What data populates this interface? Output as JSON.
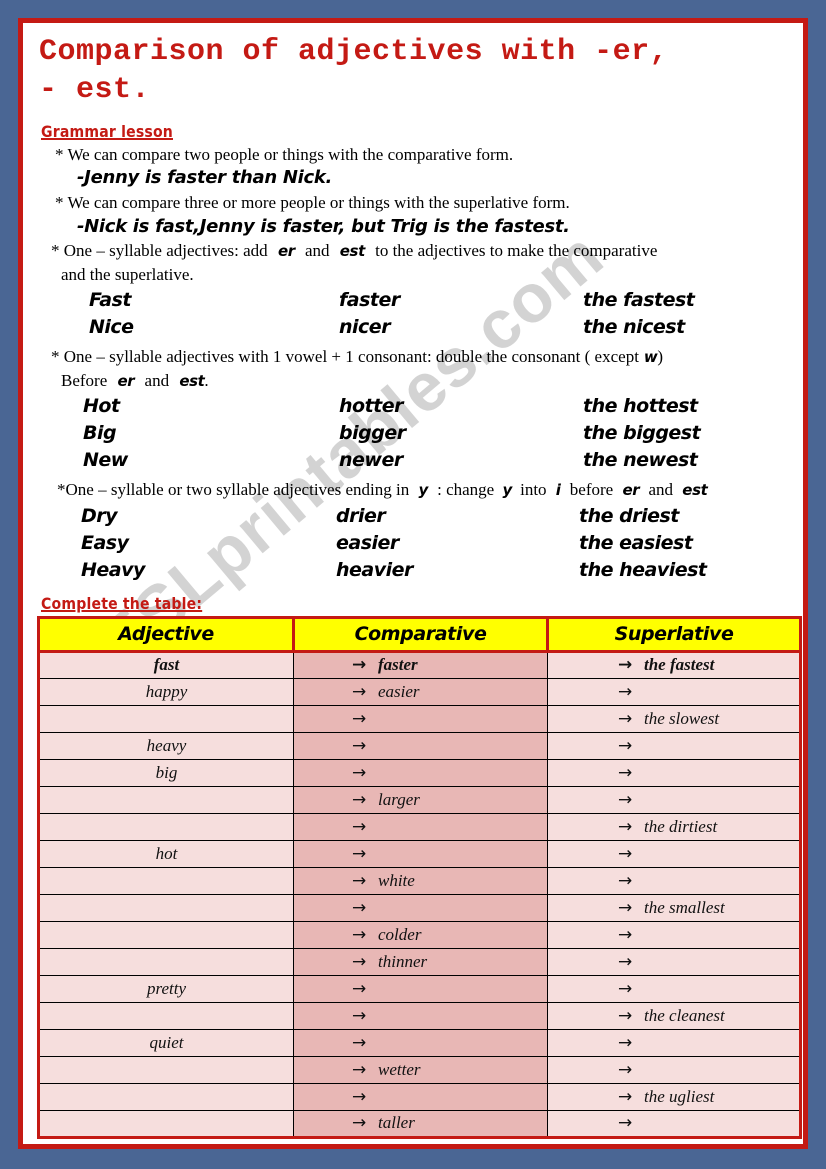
{
  "colors": {
    "page_background": "#4a6694",
    "frame_border": "#c41a14",
    "heading_red": "#c41a14",
    "table_header_bg": "#ffff00",
    "table_row_bg": "#f6dedd",
    "table_middle_col_bg": "#e8b7b5"
  },
  "watermark": {
    "text": "ESLprintables.com"
  },
  "title": "Comparison of adjectives with -er,\n- est.",
  "grammar": {
    "heading": "Grammar lesson",
    "rule1": "* We can compare two people or things with the comparative form.",
    "example1": "-Jenny is faster than Nick.",
    "rule2": "* We  can compare three or more people  or things with the superlative form.",
    "example2": "-Nick is fast,Jenny is faster, but Trig is the fastest.",
    "rule3_a": "* One – syllable  adjectives: add",
    "rule3_er": "er",
    "rule3_b": "and",
    "rule3_est": "est",
    "rule3_c": "to the adjectives  to make the comparative",
    "rule3_cont": "and the superlative.",
    "rule4": "* One – syllable adjectives with 1 vowel + 1 consonant: double the consonant ( except",
    "rule4_w": "w",
    "rule4_close": ")",
    "rule4_cont_a": "Before",
    "rule4_cont_er": "er",
    "rule4_cont_and": "and",
    "rule4_cont_est": "est",
    "rule4_cont_dot": ".",
    "rule5_a": "*One – syllable or two syllable  adjectives  ending  in",
    "rule5_y1": "y",
    "rule5_b": ": change",
    "rule5_y2": "y",
    "rule5_c": "into",
    "rule5_i": "i",
    "rule5_d": "before",
    "rule5_er": "er",
    "rule5_e": "and",
    "rule5_est": "est"
  },
  "examples": {
    "set1": [
      {
        "base": "Fast",
        "comparative": "faster",
        "superlative": "the fastest"
      },
      {
        "base": "Nice",
        "comparative": "nicer",
        "superlative": "the nicest"
      }
    ],
    "set2": [
      {
        "base": "Hot",
        "comparative": "hotter",
        "superlative": "the hottest"
      },
      {
        "base": "Big",
        "comparative": "bigger",
        "superlative": "the biggest"
      },
      {
        "base": "New",
        "comparative": "newer",
        "superlative": "the newest"
      }
    ],
    "set3": [
      {
        "base": "Dry",
        "comparative": "drier",
        "superlative": "the driest"
      },
      {
        "base": "Easy",
        "comparative": "easier",
        "superlative": "the easiest"
      },
      {
        "base": "Heavy",
        "comparative": "heavier",
        "superlative": "the heaviest"
      }
    ]
  },
  "exercise": {
    "heading": "Complete the table:",
    "columns": [
      "Adjective",
      "Comparative",
      "Superlative"
    ],
    "arrow": "→",
    "rows": [
      {
        "adjective": "fast",
        "comparative": "faster",
        "superlative": "the fastest"
      },
      {
        "adjective": "happy",
        "comparative": "easier",
        "superlative": ""
      },
      {
        "adjective": "",
        "comparative": "",
        "superlative": "the slowest"
      },
      {
        "adjective": "heavy",
        "comparative": "",
        "superlative": ""
      },
      {
        "adjective": "big",
        "comparative": "",
        "superlative": ""
      },
      {
        "adjective": "",
        "comparative": "larger",
        "superlative": ""
      },
      {
        "adjective": "",
        "comparative": "",
        "superlative": "the dirtiest"
      },
      {
        "adjective": "hot",
        "comparative": "",
        "superlative": ""
      },
      {
        "adjective": "",
        "comparative": "white",
        "superlative": ""
      },
      {
        "adjective": "",
        "comparative": "",
        "superlative": "the smallest"
      },
      {
        "adjective": "",
        "comparative": "colder",
        "superlative": ""
      },
      {
        "adjective": "",
        "comparative": "thinner",
        "superlative": ""
      },
      {
        "adjective": "pretty",
        "comparative": "",
        "superlative": ""
      },
      {
        "adjective": "",
        "comparative": "",
        "superlative": "the cleanest"
      },
      {
        "adjective": "quiet",
        "comparative": "",
        "superlative": ""
      },
      {
        "adjective": "",
        "comparative": "wetter",
        "superlative": ""
      },
      {
        "adjective": "",
        "comparative": "",
        "superlative": "the ugliest"
      },
      {
        "adjective": "",
        "comparative": "taller",
        "superlative": ""
      }
    ]
  }
}
